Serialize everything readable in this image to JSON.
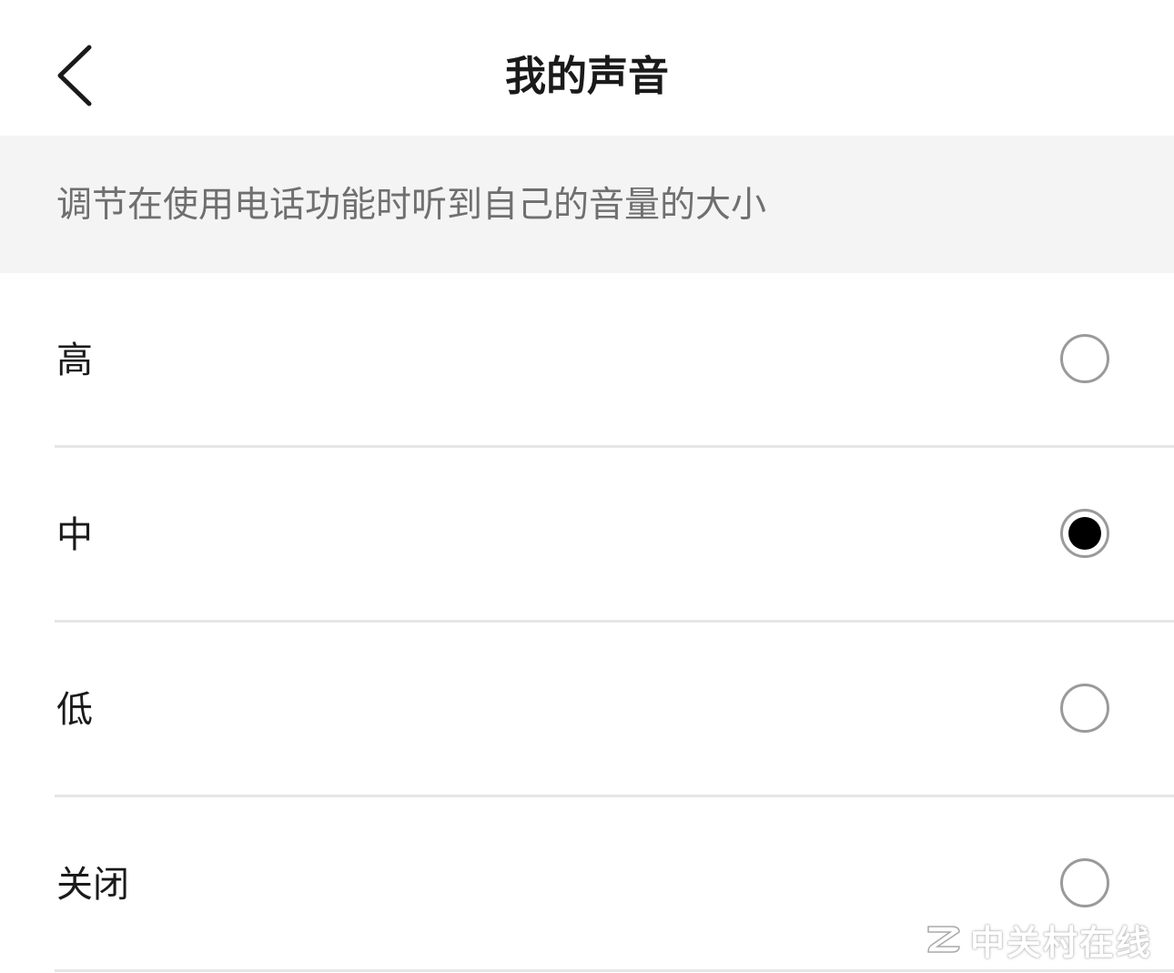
{
  "header": {
    "back_icon": "chevron-left-icon",
    "title": "我的声音"
  },
  "description": "调节在使用电话功能时听到自己的音量的大小",
  "options": [
    {
      "label": "高",
      "selected": false
    },
    {
      "label": "中",
      "selected": true
    },
    {
      "label": "低",
      "selected": false
    },
    {
      "label": "关闭",
      "selected": false
    }
  ],
  "watermark": {
    "text": "中关村在线",
    "logo_icon": "zol-logo-icon"
  },
  "colors": {
    "background": "#ffffff",
    "description_bar": "#f4f4f4",
    "title_text": "#1a1a1a",
    "description_text": "#6f6f6f",
    "radio_border": "#9a9a9a",
    "radio_selected": "#000000",
    "divider": "#e6e6e6"
  }
}
